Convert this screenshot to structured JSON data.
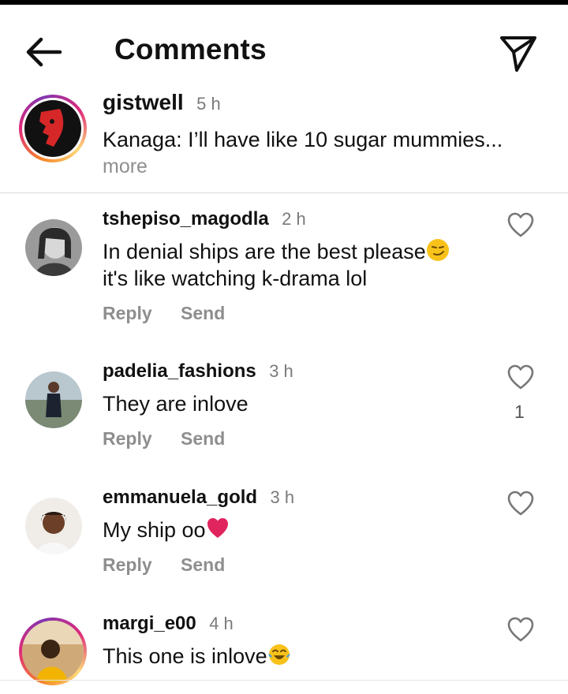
{
  "header": {
    "title": "Comments",
    "back_icon": "back-arrow-icon",
    "share_icon": "paper-plane-icon"
  },
  "caption": {
    "username": "gistwell",
    "time": "5 h",
    "text": "Kanaga: I’ll have like 10 sugar mummies...",
    "more": "more"
  },
  "comments": [
    {
      "username": "tshepiso_magodla",
      "time": "2 h",
      "text_line1": "In denial ships are the best please",
      "text_line2": "it's like watching k-drama lol",
      "reply": "Reply",
      "send": "Send",
      "likes": ""
    },
    {
      "username": "padelia_fashions",
      "time": "3 h",
      "text": "They are inlove",
      "reply": "Reply",
      "send": "Send",
      "likes": "1"
    },
    {
      "username": "emmanuela_gold",
      "time": "3 h",
      "text": "My ship oo",
      "reply": "Reply",
      "send": "Send",
      "likes": ""
    },
    {
      "username": "margi_e00",
      "time": "4 h",
      "text": "This one is inlove",
      "likes": ""
    }
  ],
  "colors": {
    "muted": "#8e8e8e",
    "divider": "#dbdbdb",
    "heart_emoji": "#e0245e"
  }
}
